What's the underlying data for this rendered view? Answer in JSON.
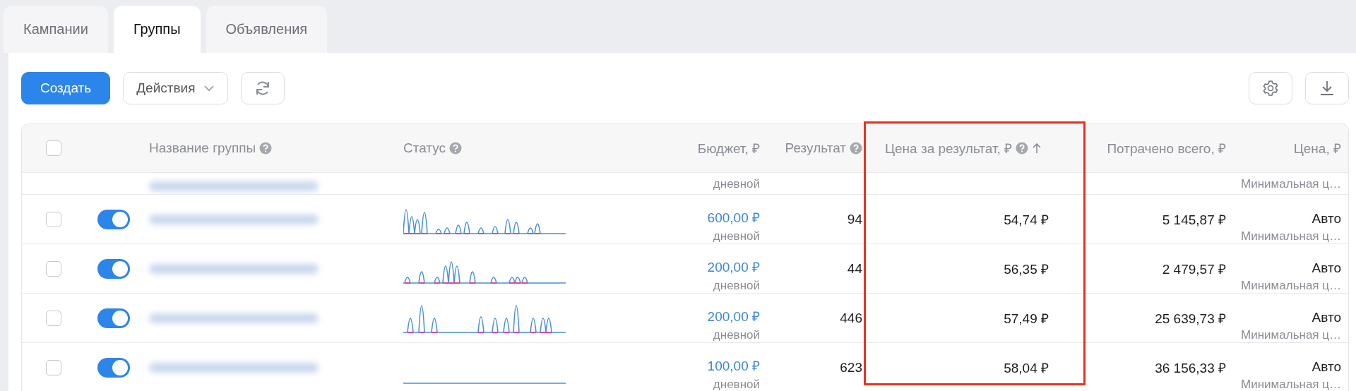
{
  "tabs": [
    {
      "label": "Кампании",
      "selected": false
    },
    {
      "label": "Группы",
      "selected": true
    },
    {
      "label": "Объявления",
      "selected": false
    }
  ],
  "toolbar": {
    "create": "Создать",
    "actions": "Действия"
  },
  "table": {
    "header_checked": false,
    "columns": [
      {
        "label": "Название группы",
        "help": true,
        "sorted": false,
        "highlighted": false
      },
      {
        "label": "Статус",
        "help": true,
        "sorted": false,
        "highlighted": false
      },
      {
        "label": "Бюджет, ₽",
        "help": false,
        "sorted": false,
        "highlighted": false
      },
      {
        "label": "Результат",
        "help": true,
        "sorted": false,
        "highlighted": false
      },
      {
        "label": "Цена за результат, ₽",
        "help": true,
        "sorted": true,
        "highlighted": true
      },
      {
        "label": "Потрачено всего, ₽",
        "help": false,
        "sorted": false,
        "highlighted": false
      },
      {
        "label": "Цена, ₽",
        "help": false,
        "sorted": false,
        "highlighted": false
      }
    ],
    "partial_row": {
      "budget_period": "дневной",
      "price_note": "Минимальная ц…"
    },
    "rows": [
      {
        "checked": false,
        "on": true,
        "kind": "peaks",
        "budget": "600,00 ₽",
        "budget_period": "дневной",
        "result": "94",
        "cost_per_result": "54,74 ₽",
        "spent": "5 145,87 ₽",
        "price": "Авто",
        "price_note": "Минимальная ц…"
      },
      {
        "checked": false,
        "on": true,
        "kind": "peaks",
        "budget": "200,00 ₽",
        "budget_period": "дневной",
        "result": "44",
        "cost_per_result": "56,35 ₽",
        "spent": "2 479,57 ₽",
        "price": "Авто",
        "price_note": "Минимальная ц…"
      },
      {
        "checked": false,
        "on": true,
        "kind": "peaks",
        "budget": "200,00 ₽",
        "budget_period": "дневной",
        "result": "446",
        "cost_per_result": "57,49 ₽",
        "spent": "25 639,73 ₽",
        "price": "Авто",
        "price_note": "Минимальная ц…"
      },
      {
        "checked": false,
        "on": true,
        "kind": "flat",
        "budget": "100,00 ₽",
        "budget_period": "дневной",
        "result": "623",
        "cost_per_result": "58,04 ₽",
        "spent": "36 156,33 ₽",
        "price": "Авто",
        "price_note": "Минимальная ц…"
      }
    ]
  }
}
